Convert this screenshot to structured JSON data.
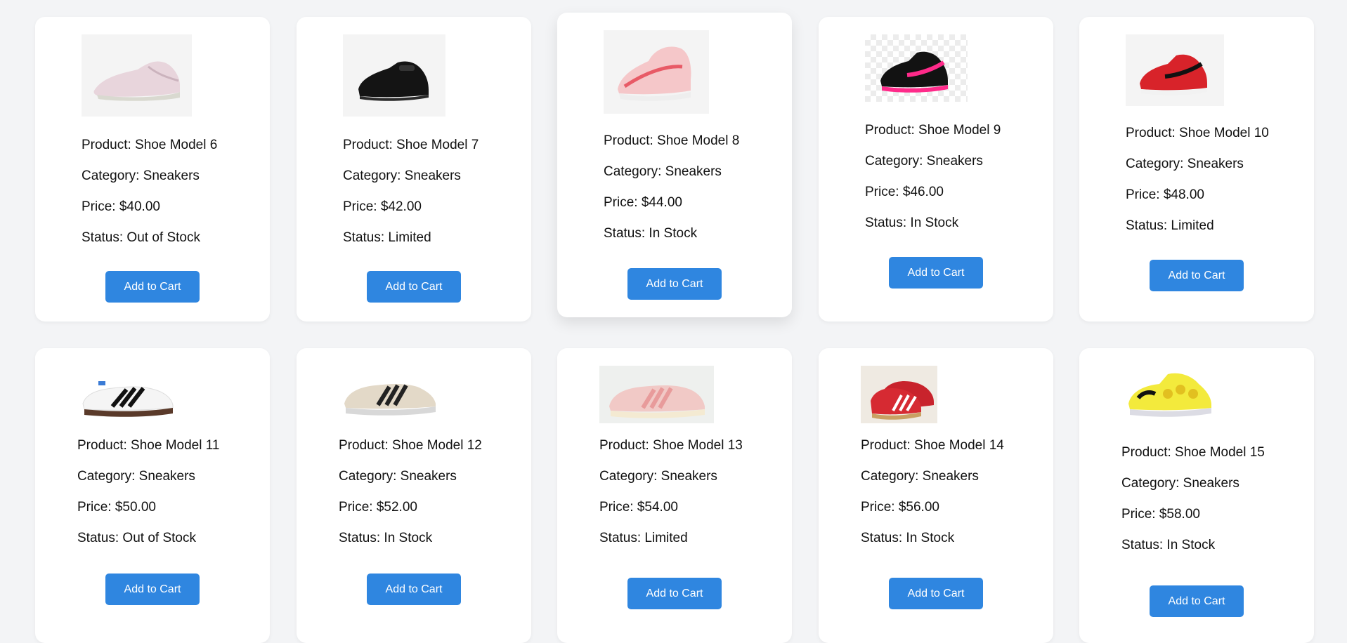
{
  "products": [
    {
      "name_line": "Product: Shoe Model 6",
      "category_line": "Category: Sneakers",
      "price_line": "Price: $40.00",
      "status_line": "Status: Out of Stock",
      "button": "Add to Cart",
      "image_icon": "pink-running-shoe-icon"
    },
    {
      "name_line": "Product: Shoe Model 7",
      "category_line": "Category: Sneakers",
      "price_line": "Price: $42.00",
      "status_line": "Status: Limited",
      "button": "Add to Cart",
      "image_icon": "black-kids-shoe-icon"
    },
    {
      "name_line": "Product: Shoe Model 8",
      "category_line": "Category: Sneakers",
      "price_line": "Price: $44.00",
      "status_line": "Status: In Stock",
      "button": "Add to Cart",
      "image_icon": "pink-slipon-shoe-icon"
    },
    {
      "name_line": "Product: Shoe Model 9",
      "category_line": "Category: Sneakers",
      "price_line": "Price: $46.00",
      "status_line": "Status: In Stock",
      "button": "Add to Cart",
      "image_icon": "black-pink-kids-shoe-icon"
    },
    {
      "name_line": "Product: Shoe Model 10",
      "category_line": "Category: Sneakers",
      "price_line": "Price: $48.00",
      "status_line": "Status: Limited",
      "button": "Add to Cart",
      "image_icon": "red-black-kids-shoe-icon"
    },
    {
      "name_line": "Product: Shoe Model 11",
      "category_line": "Category: Sneakers",
      "price_line": "Price: $50.00",
      "status_line": "Status: Out of Stock",
      "button": "Add to Cart",
      "image_icon": "white-three-stripe-shoe-icon"
    },
    {
      "name_line": "Product: Shoe Model 12",
      "category_line": "Category: Sneakers",
      "price_line": "Price: $52.00",
      "status_line": "Status: In Stock",
      "button": "Add to Cart",
      "image_icon": "beige-three-stripe-shoe-icon"
    },
    {
      "name_line": "Product: Shoe Model 13",
      "category_line": "Category: Sneakers",
      "price_line": "Price: $54.00",
      "status_line": "Status: Limited",
      "button": "Add to Cart",
      "image_icon": "pink-suede-shoe-icon"
    },
    {
      "name_line": "Product: Shoe Model 14",
      "category_line": "Category: Sneakers",
      "price_line": "Price: $56.00",
      "status_line": "Status: In Stock",
      "button": "Add to Cart",
      "image_icon": "red-three-stripe-shoe-icon"
    },
    {
      "name_line": "Product: Shoe Model 15",
      "category_line": "Category: Sneakers",
      "price_line": "Price: $58.00",
      "status_line": "Status: In Stock",
      "button": "Add to Cart",
      "image_icon": "yellow-smiley-kids-shoe-icon"
    }
  ],
  "colors": {
    "page_background": "#f3f4f6",
    "card_background": "#ffffff",
    "button_background": "#2f86e0",
    "button_text": "#ffffff"
  }
}
